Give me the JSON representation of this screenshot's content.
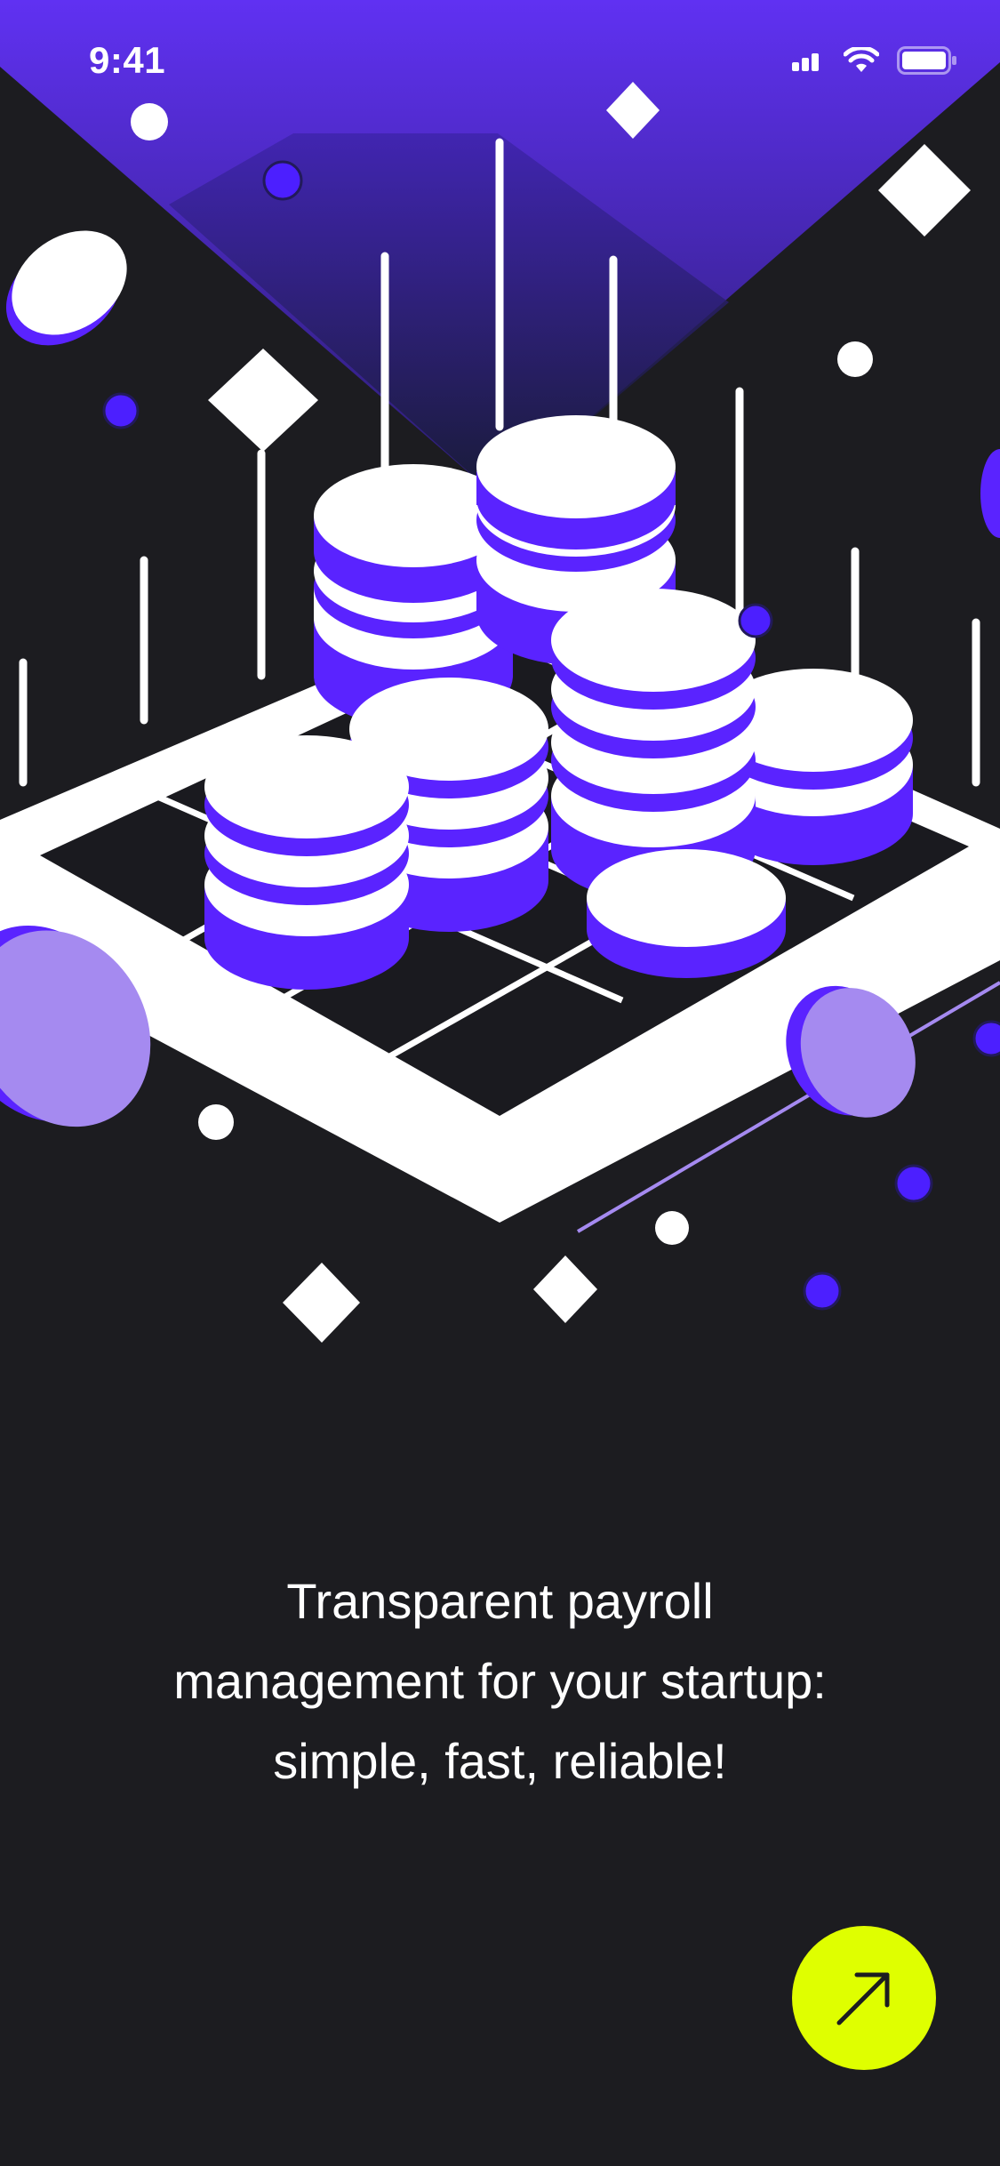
{
  "status_bar": {
    "time": "9:41",
    "icons": [
      "cellular-signal-icon",
      "wifi-icon",
      "battery-icon"
    ]
  },
  "illustration": {
    "name": "coin-stacks-on-grid-illustration",
    "colors": {
      "background": "#1c1c20",
      "spotlight": "#5b2ff0",
      "coin_face": "#ffffff",
      "coin_band": "#5a23ff",
      "coin_light": "#a58af0",
      "accent_dot": "#4c1fff"
    }
  },
  "onboarding": {
    "headline_lines": [
      "Transparent payroll",
      "management for your startup:",
      "simple, fast, reliable!"
    ]
  },
  "next_button": {
    "icon": "arrow-up-right-icon",
    "color": "#dfff00"
  }
}
